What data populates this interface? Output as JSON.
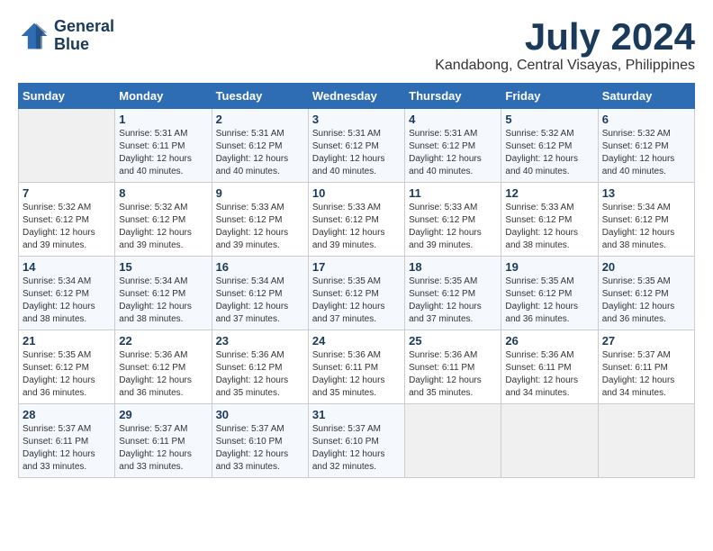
{
  "header": {
    "logo_line1": "General",
    "logo_line2": "Blue",
    "month": "July 2024",
    "location": "Kandabong, Central Visayas, Philippines"
  },
  "weekdays": [
    "Sunday",
    "Monday",
    "Tuesday",
    "Wednesday",
    "Thursday",
    "Friday",
    "Saturday"
  ],
  "weeks": [
    [
      {
        "day": "",
        "empty": true
      },
      {
        "day": "1",
        "sunrise": "5:31 AM",
        "sunset": "6:11 PM",
        "daylight": "12 hours and 40 minutes."
      },
      {
        "day": "2",
        "sunrise": "5:31 AM",
        "sunset": "6:12 PM",
        "daylight": "12 hours and 40 minutes."
      },
      {
        "day": "3",
        "sunrise": "5:31 AM",
        "sunset": "6:12 PM",
        "daylight": "12 hours and 40 minutes."
      },
      {
        "day": "4",
        "sunrise": "5:31 AM",
        "sunset": "6:12 PM",
        "daylight": "12 hours and 40 minutes."
      },
      {
        "day": "5",
        "sunrise": "5:32 AM",
        "sunset": "6:12 PM",
        "daylight": "12 hours and 40 minutes."
      },
      {
        "day": "6",
        "sunrise": "5:32 AM",
        "sunset": "6:12 PM",
        "daylight": "12 hours and 40 minutes."
      }
    ],
    [
      {
        "day": "7",
        "sunrise": "5:32 AM",
        "sunset": "6:12 PM",
        "daylight": "12 hours and 39 minutes."
      },
      {
        "day": "8",
        "sunrise": "5:32 AM",
        "sunset": "6:12 PM",
        "daylight": "12 hours and 39 minutes."
      },
      {
        "day": "9",
        "sunrise": "5:33 AM",
        "sunset": "6:12 PM",
        "daylight": "12 hours and 39 minutes."
      },
      {
        "day": "10",
        "sunrise": "5:33 AM",
        "sunset": "6:12 PM",
        "daylight": "12 hours and 39 minutes."
      },
      {
        "day": "11",
        "sunrise": "5:33 AM",
        "sunset": "6:12 PM",
        "daylight": "12 hours and 39 minutes."
      },
      {
        "day": "12",
        "sunrise": "5:33 AM",
        "sunset": "6:12 PM",
        "daylight": "12 hours and 38 minutes."
      },
      {
        "day": "13",
        "sunrise": "5:34 AM",
        "sunset": "6:12 PM",
        "daylight": "12 hours and 38 minutes."
      }
    ],
    [
      {
        "day": "14",
        "sunrise": "5:34 AM",
        "sunset": "6:12 PM",
        "daylight": "12 hours and 38 minutes."
      },
      {
        "day": "15",
        "sunrise": "5:34 AM",
        "sunset": "6:12 PM",
        "daylight": "12 hours and 38 minutes."
      },
      {
        "day": "16",
        "sunrise": "5:34 AM",
        "sunset": "6:12 PM",
        "daylight": "12 hours and 37 minutes."
      },
      {
        "day": "17",
        "sunrise": "5:35 AM",
        "sunset": "6:12 PM",
        "daylight": "12 hours and 37 minutes."
      },
      {
        "day": "18",
        "sunrise": "5:35 AM",
        "sunset": "6:12 PM",
        "daylight": "12 hours and 37 minutes."
      },
      {
        "day": "19",
        "sunrise": "5:35 AM",
        "sunset": "6:12 PM",
        "daylight": "12 hours and 36 minutes."
      },
      {
        "day": "20",
        "sunrise": "5:35 AM",
        "sunset": "6:12 PM",
        "daylight": "12 hours and 36 minutes."
      }
    ],
    [
      {
        "day": "21",
        "sunrise": "5:35 AM",
        "sunset": "6:12 PM",
        "daylight": "12 hours and 36 minutes."
      },
      {
        "day": "22",
        "sunrise": "5:36 AM",
        "sunset": "6:12 PM",
        "daylight": "12 hours and 36 minutes."
      },
      {
        "day": "23",
        "sunrise": "5:36 AM",
        "sunset": "6:12 PM",
        "daylight": "12 hours and 35 minutes."
      },
      {
        "day": "24",
        "sunrise": "5:36 AM",
        "sunset": "6:11 PM",
        "daylight": "12 hours and 35 minutes."
      },
      {
        "day": "25",
        "sunrise": "5:36 AM",
        "sunset": "6:11 PM",
        "daylight": "12 hours and 35 minutes."
      },
      {
        "day": "26",
        "sunrise": "5:36 AM",
        "sunset": "6:11 PM",
        "daylight": "12 hours and 34 minutes."
      },
      {
        "day": "27",
        "sunrise": "5:37 AM",
        "sunset": "6:11 PM",
        "daylight": "12 hours and 34 minutes."
      }
    ],
    [
      {
        "day": "28",
        "sunrise": "5:37 AM",
        "sunset": "6:11 PM",
        "daylight": "12 hours and 33 minutes."
      },
      {
        "day": "29",
        "sunrise": "5:37 AM",
        "sunset": "6:11 PM",
        "daylight": "12 hours and 33 minutes."
      },
      {
        "day": "30",
        "sunrise": "5:37 AM",
        "sunset": "6:10 PM",
        "daylight": "12 hours and 33 minutes."
      },
      {
        "day": "31",
        "sunrise": "5:37 AM",
        "sunset": "6:10 PM",
        "daylight": "12 hours and 32 minutes."
      },
      {
        "day": "",
        "empty": true
      },
      {
        "day": "",
        "empty": true
      },
      {
        "day": "",
        "empty": true
      }
    ]
  ]
}
